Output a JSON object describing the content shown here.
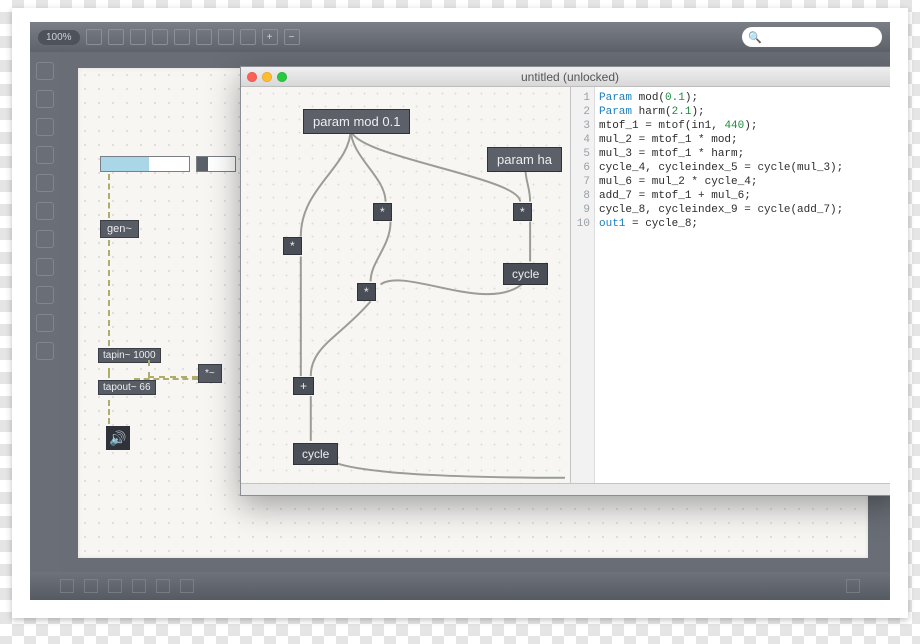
{
  "toolbar": {
    "zoom": "100%",
    "search_placeholder": ""
  },
  "window": {
    "title": "untitled (unlocked)"
  },
  "canvas_objects": {
    "gen": "gen~",
    "tapin": "tapin~ 1000",
    "tapout": "tapout~ 66"
  },
  "gen_nodes": {
    "param_mod": "param mod 0.1",
    "param_harm": "param ha",
    "cycle_top": "cycle",
    "cycle_bottom": "cycle",
    "plus": "+",
    "star1": "*",
    "star2": "*",
    "star3": "*",
    "star4": "*"
  },
  "code_lines": [
    {
      "n": 1,
      "t": "Param mod(0.1);"
    },
    {
      "n": 2,
      "t": "Param harm(2.1);"
    },
    {
      "n": 3,
      "t": "mtof_1 = mtof(in1, 440);"
    },
    {
      "n": 4,
      "t": "mul_2 = mtof_1 * mod;"
    },
    {
      "n": 5,
      "t": "mul_3 = mtof_1 * harm;"
    },
    {
      "n": 6,
      "t": "cycle_4, cycleindex_5 = cycle(mul_3);"
    },
    {
      "n": 7,
      "t": "mul_6 = mul_2 * cycle_4;"
    },
    {
      "n": 8,
      "t": "add_7 = mtof_1 + mul_6;"
    },
    {
      "n": 9,
      "t": "cycle_8, cycleindex_9 = cycle(add_7);"
    },
    {
      "n": 10,
      "t": "out1 = cycle_8;"
    }
  ]
}
